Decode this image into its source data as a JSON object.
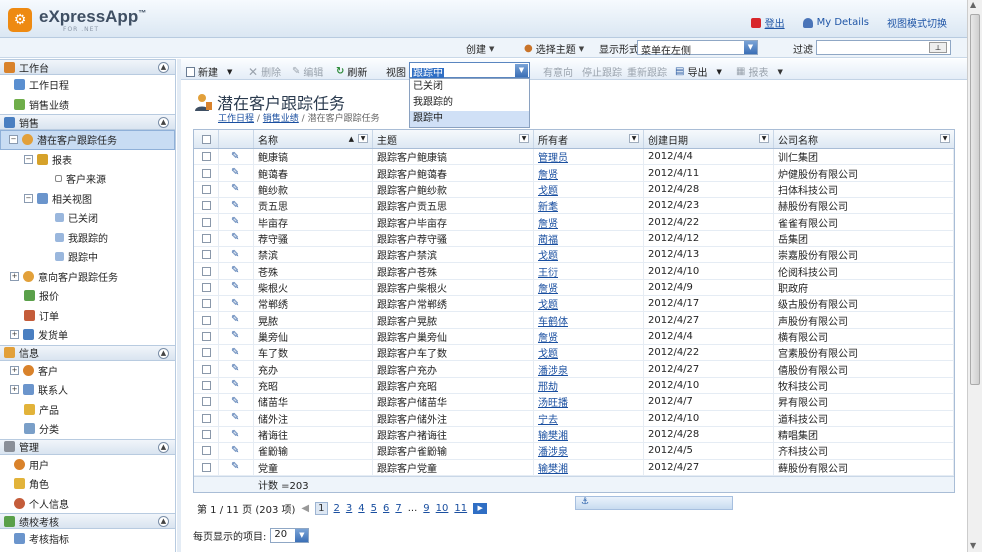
{
  "app": {
    "brand": "eXpressApp",
    "brand_sub": "FOR .NET",
    "tm": "™"
  },
  "toplinks": {
    "logout": "登出",
    "my_details": "My Details",
    "view_mode": "视图模式切换"
  },
  "cmdbar": {
    "create": "创建",
    "theme": "选择主题",
    "display_label": "显示形式",
    "display_value": "菜单在左侧",
    "filter_label": "过滤",
    "filter_value": ""
  },
  "sidebar": {
    "sections": [
      {
        "label": "工作台",
        "items": [
          {
            "label": "工作日程"
          },
          {
            "label": "销售业绩"
          }
        ]
      },
      {
        "label": "销售",
        "items": [
          {
            "label": "潜在客户跟踪任务",
            "selected": true
          },
          {
            "label": "报表"
          },
          {
            "label": "客户来源"
          },
          {
            "label": "相关视图"
          },
          {
            "label": "已关闭"
          },
          {
            "label": "我跟踪的"
          },
          {
            "label": "跟踪中"
          },
          {
            "label": "意向客户跟踪任务"
          },
          {
            "label": "报价"
          },
          {
            "label": "订单"
          },
          {
            "label": "发货单"
          }
        ]
      },
      {
        "label": "信息",
        "items": [
          {
            "label": "客户"
          },
          {
            "label": "联系人"
          },
          {
            "label": "产品"
          },
          {
            "label": "分类"
          }
        ]
      },
      {
        "label": "管理",
        "items": [
          {
            "label": "用户"
          },
          {
            "label": "角色"
          },
          {
            "label": "个人信息"
          }
        ]
      },
      {
        "label": "绩校考核",
        "items": [
          {
            "label": "考核指标"
          }
        ]
      }
    ]
  },
  "toolbar": {
    "new": "新建",
    "delete": "删除",
    "edit": "编辑",
    "refresh": "刷新",
    "view_label": "视图",
    "view_value": "跟踪中",
    "view_options": [
      "已关闭",
      "我跟踪的",
      "跟踪中"
    ],
    "interested": "有意向",
    "stop": "停止跟踪",
    "retrack": "重新跟踪",
    "export": "导出",
    "report": "报表"
  },
  "page": {
    "title": "潜在客户跟踪任务",
    "breadcrumb": [
      "工作日程",
      "销售业绩",
      "潜在客户跟踪任务"
    ]
  },
  "grid": {
    "columns": [
      "名称",
      "主题",
      "所有者",
      "创建日期",
      "公司名称"
    ],
    "rows": [
      [
        "鲍康镐",
        "跟踪客户鲍康镐",
        "管理员",
        "2012/4/4",
        "训仁集团"
      ],
      [
        "鲍蔼春",
        "跟踪客户鲍蔼春",
        "詹贤",
        "2012/4/11",
        "炉健股份有限公司"
      ],
      [
        "鲍纱款",
        "跟踪客户鲍纱款",
        "戈题",
        "2012/4/28",
        "扫体科技公司"
      ],
      [
        "贡五思",
        "跟踪客户贡五思",
        "新耄",
        "2012/4/23",
        "赫股份有限公司"
      ],
      [
        "毕亩存",
        "跟踪客户毕亩存",
        "詹贤",
        "2012/4/22",
        "雀雀有限公司"
      ],
      [
        "荐守骚",
        "跟踪客户荐守骚",
        "蔺福",
        "2012/4/12",
        "岳集团"
      ],
      [
        "禁滨",
        "跟踪客户禁滨",
        "戈题",
        "2012/4/13",
        "崇嘉股份有限公司"
      ],
      [
        "苍殊",
        "跟踪客户苍殊",
        "王衍",
        "2012/4/10",
        "伦阅科技公司"
      ],
      [
        "柴根火",
        "跟踪客户柴根火",
        "詹贤",
        "2012/4/9",
        "职政府"
      ],
      [
        "常郸绣",
        "跟踪客户常郸绣",
        "戈题",
        "2012/4/17",
        "级古股份有限公司"
      ],
      [
        "晃脓",
        "跟踪客户晃脓",
        "车鹤体",
        "2012/4/27",
        "声股份有限公司"
      ],
      [
        "巢旁仙",
        "跟踪客户巢旁仙",
        "詹贤",
        "2012/4/4",
        "横有限公司"
      ],
      [
        "车了数",
        "跟踪客户车了数",
        "戈题",
        "2012/4/22",
        "宫素股份有限公司"
      ],
      [
        "充办",
        "跟踪客户充办",
        "潘涉泉",
        "2012/4/27",
        "僖股份有限公司"
      ],
      [
        "充昭",
        "跟踪客户充昭",
        "邢劫",
        "2012/4/10",
        "牧科技公司"
      ],
      [
        "储苗华",
        "跟踪客户储苗华",
        "汤旺播",
        "2012/4/7",
        "昇有限公司"
      ],
      [
        "储外注",
        "跟踪客户储外注",
        "宁去",
        "2012/4/10",
        "道科技公司"
      ],
      [
        "褚诲往",
        "跟踪客户褚诲往",
        "输樊湘",
        "2012/4/28",
        "精唱集团"
      ],
      [
        "雀鼢输",
        "跟踪客户雀鼢输",
        "潘涉泉",
        "2012/4/5",
        "齐科技公司"
      ],
      [
        "党童",
        "跟踪客户党童",
        "输樊湘",
        "2012/4/27",
        "藓股份有限公司"
      ]
    ],
    "footer": "计数 =203"
  },
  "pager": {
    "info": "第 1 / 11 页 (203 项)",
    "pages": [
      "1",
      "2",
      "3",
      "4",
      "5",
      "6",
      "7",
      "...",
      "9",
      "10",
      "11"
    ],
    "loading": ""
  },
  "page_size": {
    "label": "每页显示的项目:",
    "value": "20"
  }
}
